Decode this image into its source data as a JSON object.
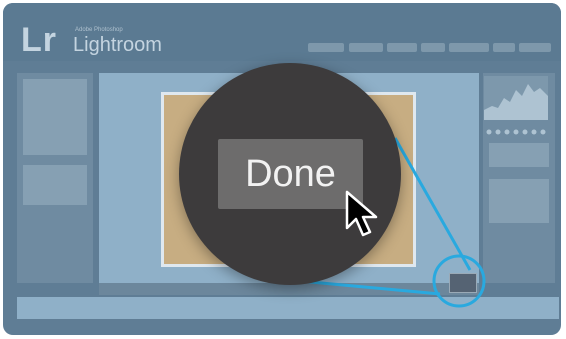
{
  "app": {
    "brand_short": "Lr",
    "brand_sub": "Adobe Photoshop",
    "brand_name": "Lightroom"
  },
  "magnifier": {
    "button_label": "Done"
  },
  "icons": {
    "cursor": "arrow-cursor-icon",
    "histogram": "histogram-icon"
  },
  "colors": {
    "callout": "#29a9df",
    "background": "#5f7d95",
    "photo": "#c7ad82",
    "magnifier": "#3d3b3c"
  }
}
